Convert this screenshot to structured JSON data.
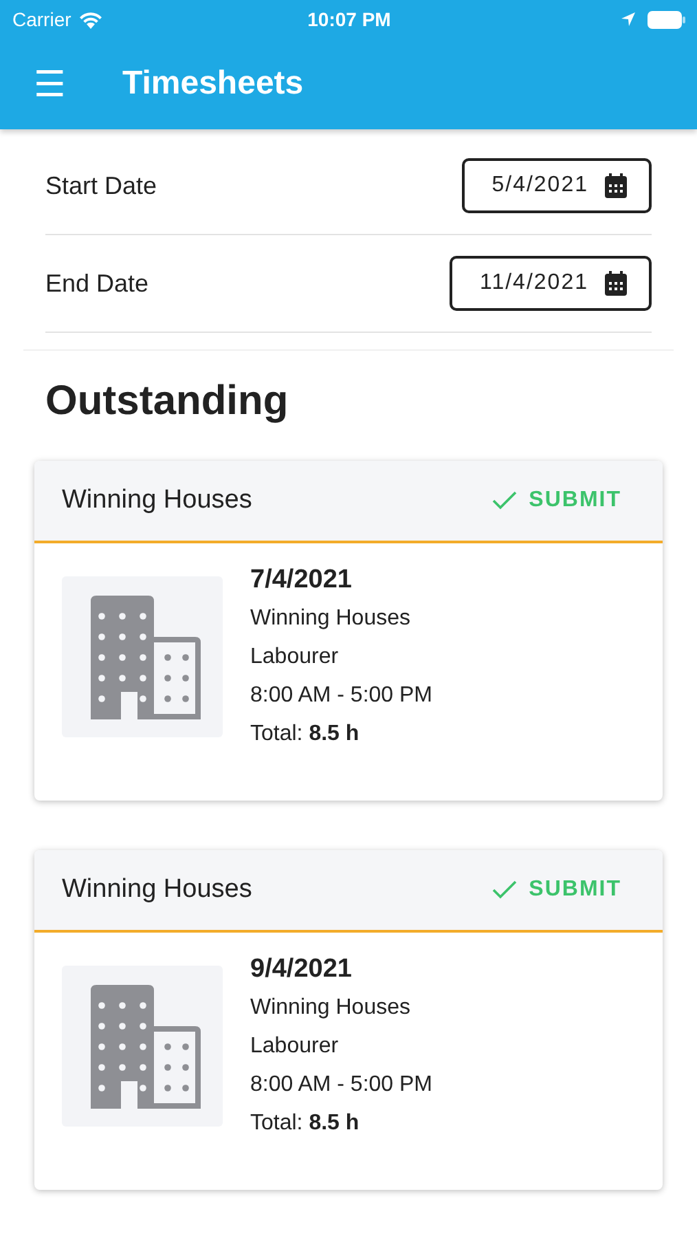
{
  "status_bar": {
    "carrier": "Carrier",
    "time": "10:07 PM"
  },
  "app_bar": {
    "menu_icon": "☰",
    "title": "Timesheets"
  },
  "filters": [
    {
      "label": "Start Date",
      "value": "5/4/2021"
    },
    {
      "label": "End Date",
      "value": "11/4/2021"
    }
  ],
  "section": {
    "title": "Outstanding"
  },
  "timesheets": [
    {
      "employer": "Winning Houses",
      "action": "SUBMIT",
      "date": "7/4/2021",
      "site": "Winning Houses",
      "role": "Labourer",
      "hours": "8:00 AM - 5:00 PM",
      "total": "Total: **8.5 h**"
    },
    {
      "employer": "Winning Houses",
      "action": "SUBMIT",
      "date": "9/4/2021",
      "site": "Winning Houses",
      "role": "Labourer",
      "hours": "8:00 AM - 5:00 PM",
      "total": "Total: **8.5 h**"
    }
  ]
}
